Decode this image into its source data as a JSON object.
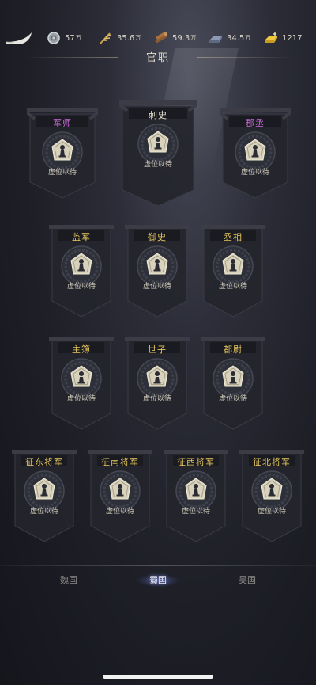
{
  "header": {
    "title": "官职",
    "resources": [
      {
        "name": "silver",
        "icon": "coin-icon",
        "value": "57",
        "unit": "万"
      },
      {
        "name": "grain",
        "icon": "wheat-icon",
        "value": "35.6",
        "unit": "万"
      },
      {
        "name": "wood",
        "icon": "wood-icon",
        "value": "59.3",
        "unit": "万"
      },
      {
        "name": "iron",
        "icon": "iron-icon",
        "value": "34.5",
        "unit": "万"
      },
      {
        "name": "gold",
        "icon": "gold-icon",
        "value": "1217",
        "unit": ""
      }
    ]
  },
  "positions": [
    {
      "name": "军师",
      "status": "虚位以待",
      "color": "#c86cd8"
    },
    {
      "name": "刺史",
      "status": "虚位以待",
      "color": "#e7e2d2"
    },
    {
      "name": "郡丞",
      "status": "虚位以待",
      "color": "#c86cd8"
    },
    {
      "name": "监军",
      "status": "虚位以待",
      "color": "#e8c860"
    },
    {
      "name": "御史",
      "status": "虚位以待",
      "color": "#e8c860"
    },
    {
      "name": "丞相",
      "status": "虚位以待",
      "color": "#e8c860"
    },
    {
      "name": "主簿",
      "status": "虚位以待",
      "color": "#e8c860"
    },
    {
      "name": "世子",
      "status": "虚位以待",
      "color": "#e8c860"
    },
    {
      "name": "都尉",
      "status": "虚位以待",
      "color": "#e8c860"
    },
    {
      "name": "征东将军",
      "status": "虚位以待",
      "color": "#e8c860"
    },
    {
      "name": "征南将军",
      "status": "虚位以待",
      "color": "#e8c860"
    },
    {
      "name": "征西将军",
      "status": "虚位以待",
      "color": "#e8c860"
    },
    {
      "name": "征北将军",
      "status": "虚位以待",
      "color": "#e8c860"
    }
  ],
  "tabs": [
    {
      "label": "魏国",
      "active": false
    },
    {
      "label": "蜀国",
      "active": true
    },
    {
      "label": "吴国",
      "active": false
    }
  ]
}
